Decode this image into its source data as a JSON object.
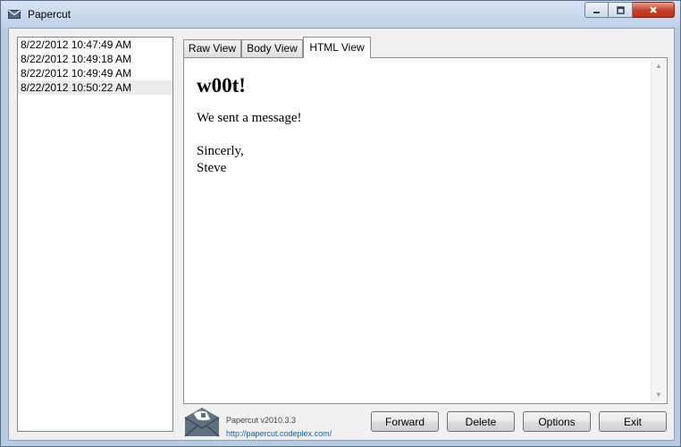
{
  "window": {
    "title": "Papercut",
    "controls": [
      "minimize-icon",
      "maximize-icon",
      "close-icon"
    ]
  },
  "messages": [
    {
      "timestamp": "8/22/2012 10:47:49 AM",
      "selected": false
    },
    {
      "timestamp": "8/22/2012 10:49:18 AM",
      "selected": false
    },
    {
      "timestamp": "8/22/2012 10:49:49 AM",
      "selected": false
    },
    {
      "timestamp": "8/22/2012 10:50:22 AM",
      "selected": true
    }
  ],
  "tabs": [
    {
      "label": "Raw View",
      "active": false
    },
    {
      "label": "Body View",
      "active": false
    },
    {
      "label": "HTML View",
      "active": true
    }
  ],
  "html_view": {
    "heading": "w00t!",
    "body": "We sent a message!",
    "signoff": "Sincerly,",
    "signature": "Steve"
  },
  "footer": {
    "version": "Papercut v2010.3.3",
    "link": "http://papercut.codeplex.com/"
  },
  "buttons": {
    "forward": "Forward",
    "delete": "Delete",
    "options": "Options",
    "exit": "Exit"
  },
  "colors": {
    "title_bar": "#bfd1e7",
    "close_button": "#c8442c",
    "selected_row": "#ececec",
    "link": "#0066cc"
  }
}
